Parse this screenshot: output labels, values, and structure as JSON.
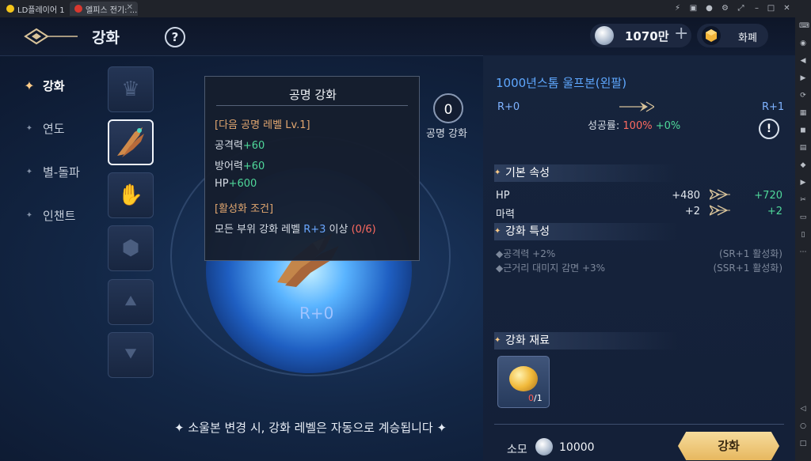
{
  "emulator": {
    "tabs": [
      {
        "label": "LD플레이어 1"
      },
      {
        "label": "엘피스 전기: ..."
      }
    ]
  },
  "header": {
    "title": "강화",
    "help_label": "?",
    "currency_amount": "1070만",
    "currency_plus": "+",
    "wallet_label": "화폐"
  },
  "menu": [
    {
      "label": "강화",
      "active": true
    },
    {
      "label": "연도",
      "active": false
    },
    {
      "label": "별-돌파",
      "active": false
    },
    {
      "label": "인챈트",
      "active": false
    }
  ],
  "center": {
    "rank": "R+0",
    "notice": "✦ 소울본 변경 시, 강화 레벨은 자동으로 계승됩니다 ✦",
    "prestige_value": "0",
    "prestige_label": "공명 강화"
  },
  "tooltip": {
    "title": "공명 강화",
    "next_level": "[다음 공명 레벨 Lv.1]",
    "lines": [
      {
        "stat": "공격력",
        "value": "+60"
      },
      {
        "stat": "방어력",
        "value": "+60"
      },
      {
        "stat": "HP",
        "value": "+600"
      }
    ],
    "condition_head": "[활성화 조건]",
    "condition_prefix": "모든 부위 강화 레벨 ",
    "condition_level": "R+3",
    "condition_mid": " 이상 ",
    "condition_progress": "(0/6)"
  },
  "panel": {
    "item_name": "1000년스톰 울프본(왼팔)",
    "from": "R+0",
    "to": "R+1",
    "success_label": "성공률: ",
    "success_rate": "100%",
    "success_bonus": " +0%",
    "warn_label": "!",
    "base_title": "기본 속성",
    "stats": [
      {
        "name": "HP",
        "current": "+480",
        "next": "+720"
      },
      {
        "name": "마력",
        "current": "+2",
        "next": "+2"
      }
    ],
    "trait_title": "강화 특성",
    "traits": [
      {
        "name": "◆공격력 +2%",
        "cond": "(SR+1 활성화)"
      },
      {
        "name": "◆근거리 대미지 감면 +3%",
        "cond": "(SSR+1 활성화)"
      }
    ],
    "material_title": "강화 재료",
    "material_have": "0",
    "material_need": "/1",
    "cost_label": "소모",
    "cost_value": "10000",
    "enhance_label": "강화"
  },
  "colors": {
    "accent_blue": "#5fa8ff",
    "green": "#4fd89a",
    "red": "#ff6a60",
    "gold_button": "#e7b85f"
  }
}
